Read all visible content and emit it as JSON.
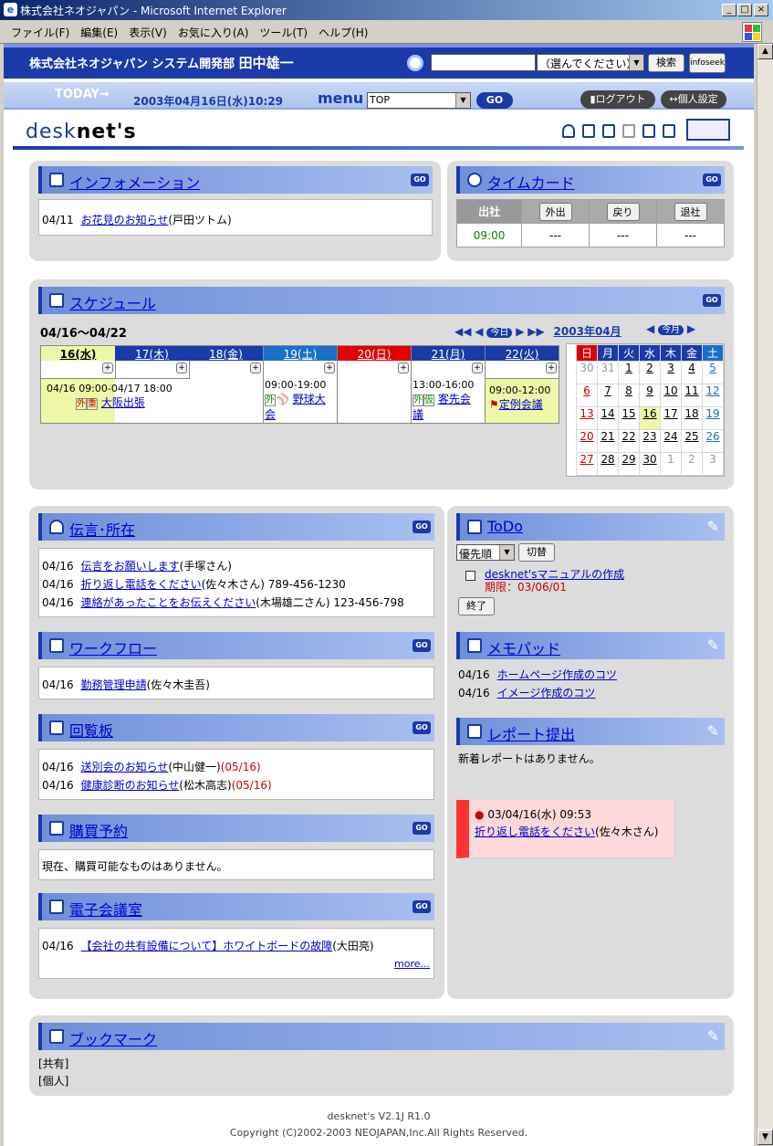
{
  "window": {
    "title": "株式会社ネオジャパン - Microsoft Internet Explorer"
  },
  "menu": [
    "ファイル(F)",
    "編集(E)",
    "表示(V)",
    "お気に入り(A)",
    "ツール(T)",
    "ヘルプ(H)"
  ],
  "header": {
    "company": "株式会社ネオジャパン システム開発部",
    "user": "田中雄一",
    "search_select": "（選んでください）",
    "search_button": "検索",
    "infoseek": "infoseek",
    "today_label": "TODAY",
    "datetime": "2003年04月16日(水)10:29",
    "menu_label": "menu",
    "menu_value": "TOP",
    "go_label": "GO",
    "logout": "ログアウト",
    "personal": "個人設定"
  },
  "logo": {
    "part1": "desk",
    "part2": "net's"
  },
  "information": {
    "title": "インフォメーション",
    "items": [
      {
        "date": "04/11",
        "link": "お花見のお知らせ",
        "who": "(戸田ツトム)"
      }
    ]
  },
  "timecard": {
    "title": "タイムカード",
    "heads": [
      "出社",
      "外出",
      "戻り",
      "退社"
    ],
    "values": [
      "09:00",
      "---",
      "---",
      "---"
    ]
  },
  "schedule": {
    "title": "スケジュール",
    "range": "04/16～04/22",
    "month_label": "2003年04月",
    "today_btn": "今日",
    "month_btn": "今月",
    "days": [
      {
        "label": "16(水)",
        "color": "#000"
      },
      {
        "label": "17(木)",
        "color": "#fff"
      },
      {
        "label": "18(金)",
        "color": "#fff"
      },
      {
        "label": "19(土)",
        "color": "#fff"
      },
      {
        "label": "20(日)",
        "color": "#fff"
      },
      {
        "label": "21(月)",
        "color": "#fff"
      },
      {
        "label": "22(火)",
        "color": "#fff"
      }
    ],
    "event1_time": "04/16 09:00-04/17 18:00",
    "event1_tags": [
      "外",
      "重"
    ],
    "event1_link": "大阪出張",
    "event2_time": "09:00-19:00",
    "event2_tag": "外",
    "event2_link1": "野球大",
    "event2_link2": "会",
    "event3_time": "13:00-16:00",
    "event3_tags": [
      "外",
      "仮"
    ],
    "event3_link1": "客先会",
    "event3_link2": "議",
    "event4_time": "09:00-12:00",
    "event4_link": "定例会議",
    "mini_heads": [
      "日",
      "月",
      "火",
      "水",
      "木",
      "金",
      "土"
    ],
    "mini_weeks": [
      [
        "30",
        "31",
        "1",
        "2",
        "3",
        "4",
        "5"
      ],
      [
        "6",
        "7",
        "8",
        "9",
        "10",
        "11",
        "12"
      ],
      [
        "13",
        "14",
        "15",
        "16",
        "17",
        "18",
        "19"
      ],
      [
        "20",
        "21",
        "22",
        "23",
        "24",
        "25",
        "26"
      ],
      [
        "27",
        "28",
        "29",
        "30",
        "1",
        "2",
        "3"
      ]
    ]
  },
  "message": {
    "title": "伝言･所在",
    "items": [
      {
        "date": "04/16",
        "link": "伝言をお願いします",
        "who": "(手塚さん)"
      },
      {
        "date": "04/16",
        "link": "折り返し電話をください",
        "who": "(佐々木さん) 789-456-1230"
      },
      {
        "date": "04/16",
        "link": "連絡があったことをお伝えください",
        "who": "(木場雄二さん) 123-456-798"
      }
    ]
  },
  "workflow": {
    "title": "ワークフロー",
    "items": [
      {
        "date": "04/16",
        "link": "勤務管理申請",
        "who": "(佐々木圭吾)"
      }
    ]
  },
  "circular": {
    "title": "回覧板",
    "items": [
      {
        "date": "04/16",
        "link": "送別会のお知らせ",
        "who": "(中山健一)",
        "deadline": "(05/16)"
      },
      {
        "date": "04/16",
        "link": "健康診断のお知らせ",
        "who": "(松木高志)",
        "deadline": "(05/16)"
      }
    ]
  },
  "purchase": {
    "title": "購買予約",
    "text": "現在、購買可能なものはありません。"
  },
  "meeting": {
    "title": "電子会議室",
    "items": [
      {
        "date": "04/16",
        "link": "【会社の共有設備について】ホワイトボードの故障",
        "who": "(大田亮)"
      }
    ],
    "more": "more..."
  },
  "todo": {
    "title": "ToDo",
    "sort": "優先順",
    "switch": "切替",
    "item": "desknet'sマニュアルの作成",
    "deadline": "期限：03/06/01",
    "done": "終了"
  },
  "memo": {
    "title": "メモパッド",
    "items": [
      {
        "date": "04/16",
        "link": "ホームページ作成のコツ"
      },
      {
        "date": "04/16",
        "link": "イメージ作成のコツ"
      }
    ]
  },
  "report": {
    "title": "レポート提出",
    "text": "新着レポートはありません。"
  },
  "alert": {
    "time": "03/04/16(水) 09:53",
    "link": "折り返し電話をください",
    "who": "(佐々木さん)"
  },
  "bookmark": {
    "title": "ブックマーク",
    "shared": "[共有]",
    "personal": "[個人]"
  },
  "footer": {
    "version": "desknet's V2.1J R1.0",
    "copyright": "Copyright (C)2002-2003 NEOJAPAN,Inc.All Rights Reserved."
  },
  "colors": {
    "brand": "#1a3aa8",
    "panel_head": "#7d92e3",
    "today": "#eef7a8",
    "saturday": "#1a6fc9",
    "sunday": "#e00000"
  }
}
